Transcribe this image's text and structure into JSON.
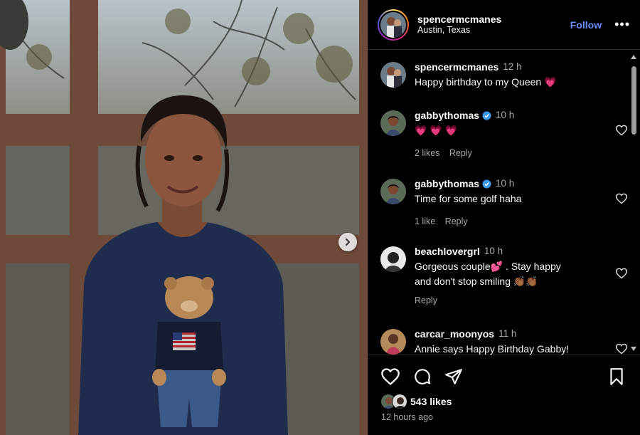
{
  "post": {
    "username": "spencermcmanes",
    "location": "Austin, Texas",
    "follow_label": "Follow",
    "more_label": "•••"
  },
  "photo": {
    "description_icon": "next-arrow-icon"
  },
  "comments": [
    {
      "user": "spencermcmanes",
      "time": "12 h",
      "verified": false,
      "text": "Happy birthday to my Queen 💗",
      "likes": "",
      "reply": ""
    },
    {
      "user": "gabbythomas",
      "time": "10 h",
      "verified": true,
      "text": "💗 💗 💗",
      "likes": "2 likes",
      "reply": "Reply"
    },
    {
      "user": "gabbythomas",
      "time": "10 h",
      "verified": true,
      "text": "Time for some golf haha",
      "likes": "1 like",
      "reply": "Reply"
    },
    {
      "user": "beachlovergrl",
      "time": "10 h",
      "verified": false,
      "text_line1": "Gorgeous couple💕 . Stay happy",
      "text_line2": "and don't stop smiling 👏🏾👏🏾",
      "likes": "",
      "reply": "Reply"
    },
    {
      "user": "carcar_moonyos",
      "time": "11 h",
      "verified": false,
      "text": "Annie says Happy Birthday Gabby!",
      "likes": "",
      "reply": ""
    }
  ],
  "footer": {
    "likes": "543 likes",
    "time_ago": "12 hours ago"
  },
  "colors": {
    "follow": "#6b8cff",
    "verified": "#3897f0",
    "heart_emoji": "#ff3b5c",
    "background": "#000000"
  }
}
